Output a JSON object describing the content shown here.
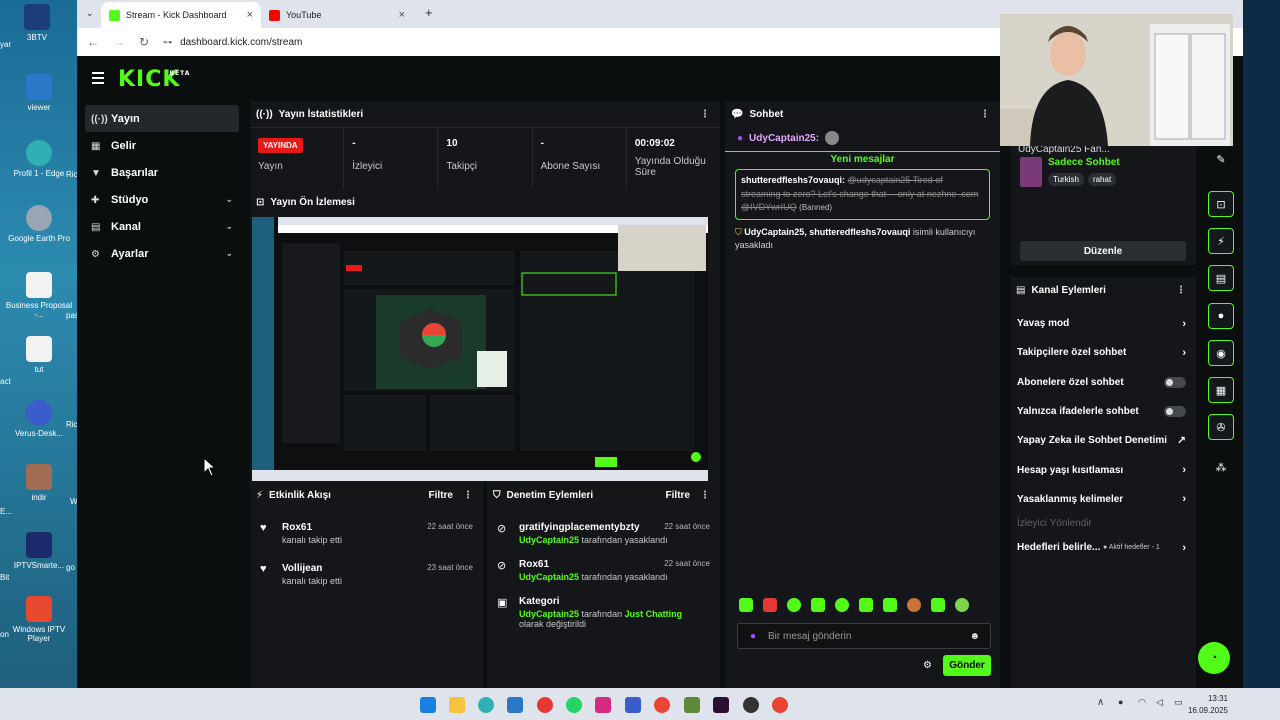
{
  "desktop": {
    "icons": [
      "3BTV",
      "viewer",
      "Profil 1 - Edge",
      "Google Earth Pro",
      "Business Proposal -...",
      "tut",
      "Verus-Desk...",
      "indir",
      "IPTVSmarte...",
      "Windows IPTV Player"
    ],
    "left_edge_labels": [
      "yar",
      "Ric",
      "pas",
      "act",
      "Ric",
      "E...",
      "Bit",
      "W",
      "go",
      "on"
    ]
  },
  "browser": {
    "tabs": [
      {
        "title": "Stream - Kick Dashboard",
        "color": "#53fc18"
      },
      {
        "title": "YouTube",
        "color": "#ff0000"
      }
    ],
    "new_tab": "+",
    "url": "dashboard.kick.com/stream"
  },
  "kick": {
    "logo": "KICK",
    "logo_beta": "BETA",
    "nav": [
      {
        "label": "Yayın",
        "icon": "broadcast-icon",
        "glyph": "((·))",
        "active": true
      },
      {
        "label": "Gelir",
        "icon": "money-icon",
        "glyph": "▦"
      },
      {
        "label": "Başarılar",
        "icon": "trophy-icon",
        "glyph": "▼"
      },
      {
        "label": "Stüdyo",
        "icon": "studio-icon",
        "glyph": "✚",
        "chevron": "⌄"
      },
      {
        "label": "Kanal",
        "icon": "channel-icon",
        "glyph": "▤",
        "chevron": "⌄"
      },
      {
        "label": "Ayarlar",
        "icon": "gear-icon",
        "glyph": "⚙",
        "chevron": "⌄"
      }
    ],
    "stats": {
      "title": "Yayın İstatistikleri",
      "live": "YAYINDA",
      "items": [
        {
          "value": "",
          "label": "Yayın",
          "badge": true
        },
        {
          "value": "-",
          "label": "İzleyici"
        },
        {
          "value": "10",
          "label": "Takipçi"
        },
        {
          "value": "-",
          "label": "Abone Sayısı"
        },
        {
          "value": "00:09:02",
          "label": "Yayında Olduğu Süre"
        }
      ]
    },
    "preview": {
      "title": "Yayın Ön İzlemesi"
    },
    "activity": {
      "title": "Etkinlik Akışı",
      "filter": "Filtre",
      "items": [
        {
          "name": "Rox61",
          "sub": "kanalı takip etti",
          "time": "22 saat önce"
        },
        {
          "name": "Vollijean",
          "sub": "kanalı takip etti",
          "time": "23 saat önce"
        }
      ]
    },
    "moderation": {
      "title": "Denetim Eylemleri",
      "filter": "Filtre",
      "items": [
        {
          "name": "gratifyingplacementybzty",
          "actor": "UdyCaptain25",
          "text": "tarafından yasaklandı",
          "time": "22 saat önce"
        },
        {
          "name": "Rox61",
          "actor": "UdyCaptain25",
          "text": "tarafından yasaklandı",
          "time": "22 saat önce"
        },
        {
          "name": "Kategori",
          "actor": "UdyCaptain25",
          "text_pre": "tarafından",
          "highlight": "Just Chatting",
          "text_post": "olarak değiştirildi",
          "time": "22 saat önce"
        }
      ]
    },
    "chat": {
      "title": "Sohbet",
      "pinned_user": "UdyCaptain25:",
      "new_messages": "Yeni mesajlar",
      "messages": [
        {
          "user": "shutteredfleshs7ovauqi:",
          "text": "@udycaptain25 Tired of streaming to zero? Let's change that —only at nezhne .com @IVDYwrIUQ",
          "tag": "(Banned)"
        },
        {
          "user": "UdyCaptain25, shutteredfleshs7ovauqi",
          "text": "isimli kullanıcıyı yasakladı"
        }
      ],
      "placeholder": "Bir mesaj gönderin",
      "send": "Gönder"
    },
    "channel_info": {
      "title_partial": "UdyCaptain25 Fan...",
      "chat_mode": "Sadece Sohbet",
      "tags": [
        "Turkish",
        "rahat"
      ],
      "edit": "Düzenle"
    },
    "channel_actions": {
      "title": "Kanal Eylemleri",
      "rows": [
        {
          "label": "Yavaş mod",
          "type": "arrow",
          "glyph": "›"
        },
        {
          "label": "Takipçilere özel sohbet",
          "type": "arrow",
          "glyph": "›"
        },
        {
          "label": "Abonelere özel sohbet",
          "type": "toggle"
        },
        {
          "label": "Yalnızca ifadelerle sohbet",
          "type": "toggle"
        },
        {
          "label": "Yapay Zeka ile Sohbet Denetimi",
          "type": "external",
          "glyph": "↗"
        },
        {
          "label": "Hesap yaşı kısıtlaması",
          "type": "arrow",
          "glyph": "›"
        },
        {
          "label": "Yasaklanmış kelimeler",
          "type": "arrow",
          "glyph": "›"
        }
      ],
      "section": "İzleyici Yönlendir",
      "goals_label": "Hedefleri belirle...",
      "goals_status": "● Aktif hedefler - 1",
      "goals_arrow": "›"
    }
  },
  "taskbar": {
    "time": "13:31",
    "date": "16.09.2025",
    "tray": "∧"
  }
}
